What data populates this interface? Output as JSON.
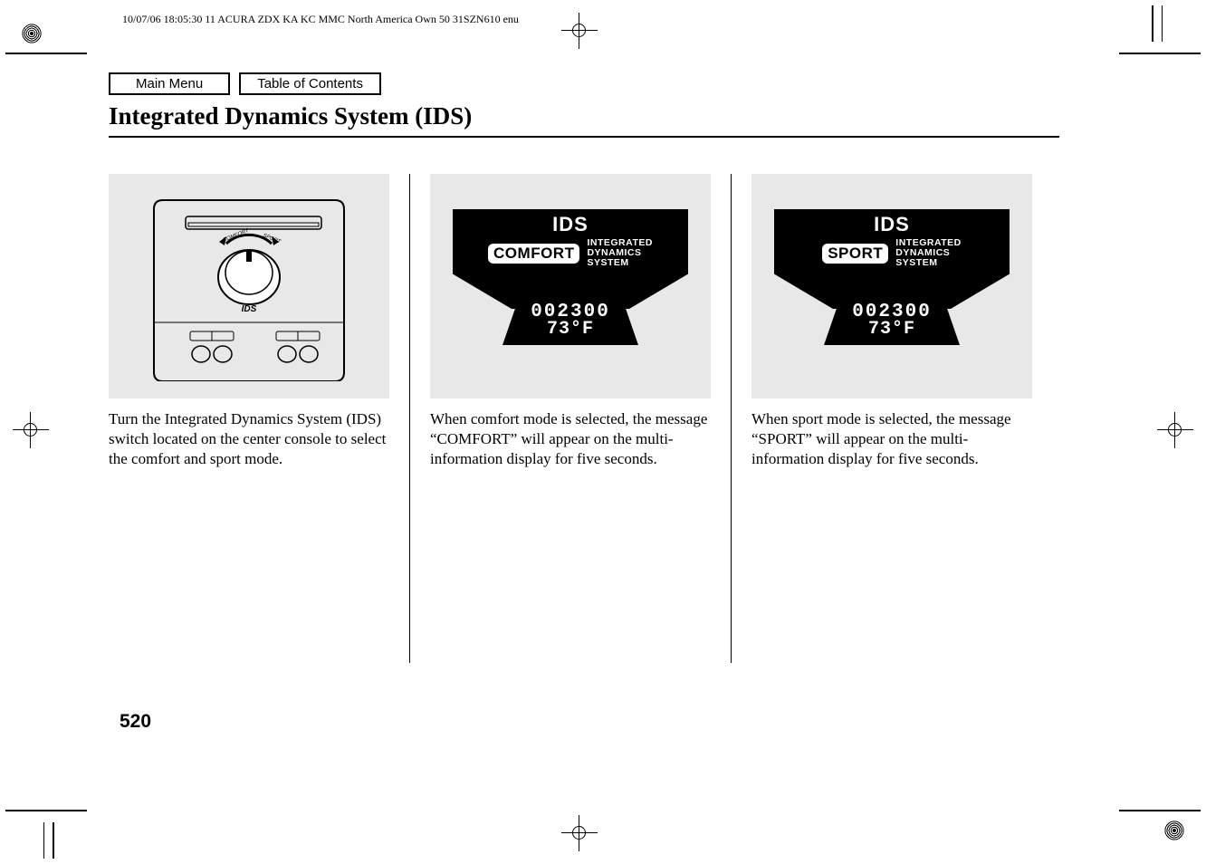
{
  "meta_header": "10/07/06 18:05:30   11 ACURA ZDX KA KC MMC North America Own 50 31SZN610 enu",
  "nav": {
    "main_menu": "Main Menu",
    "toc": "Table of Contents"
  },
  "title": "Integrated Dynamics System (IDS)",
  "console": {
    "label_comfort": "COMFORT",
    "label_sport": "SPORT",
    "label_ids": "IDS"
  },
  "display": {
    "heading": "IDS",
    "sub_line1": "INTEGRATED",
    "sub_line2": "DYNAMICS",
    "sub_line3": "SYSTEM",
    "odometer": "002300",
    "temp": "73°F"
  },
  "modes": {
    "comfort": "COMFORT",
    "sport": "SPORT"
  },
  "captions": {
    "c1": "Turn the Integrated Dynamics System (IDS) switch located on the center console to select the comfort and sport mode.",
    "c2": "When comfort mode is selected, the message “COMFORT” will appear on the multi-information display for five seconds.",
    "c3": "When sport mode is selected, the message “SPORT” will appear on the multi-information display for five seconds."
  },
  "page_number": "520"
}
